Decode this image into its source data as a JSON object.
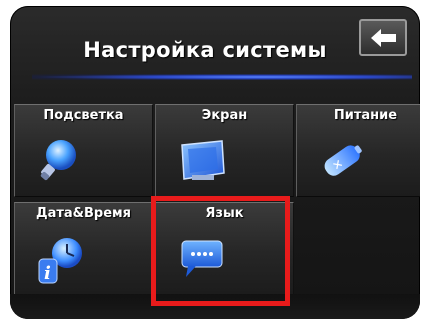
{
  "header": {
    "title": "Настройка системы"
  },
  "tiles": [
    {
      "label": "Подсветка",
      "icon": "lightbulb-icon"
    },
    {
      "label": "Экран",
      "icon": "screen-icon"
    },
    {
      "label": "Питание",
      "icon": "battery-icon"
    },
    {
      "label": "Дата&Время",
      "icon": "clock-info-icon"
    },
    {
      "label": "Язык",
      "icon": "speech-bubble-icon"
    }
  ],
  "colors": {
    "highlight": "#e81b1b",
    "accent_line": "#3a5cff",
    "icon_blue": "#3b8cff"
  }
}
